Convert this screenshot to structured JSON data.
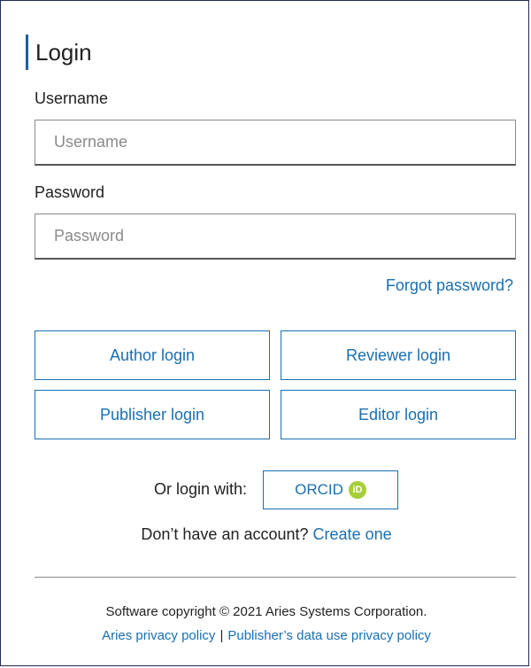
{
  "title": "Login",
  "username": {
    "label": "Username",
    "placeholder": "Username"
  },
  "password": {
    "label": "Password",
    "placeholder": "Password"
  },
  "forgot_password": "Forgot password?",
  "role_buttons": {
    "author": "Author login",
    "reviewer": "Reviewer login",
    "publisher": "Publisher login",
    "editor": "Editor login"
  },
  "orcid": {
    "prompt": "Or login with:",
    "button_label": "ORCID",
    "icon_text": "iD",
    "icon": "orcid-icon",
    "icon_color": "#a6ce39"
  },
  "account": {
    "prompt": "Don’t have an account?",
    "link": "Create one"
  },
  "footer": {
    "copyright": "Software copyright © 2021 Aries Systems Corporation.",
    "privacy_link": "Aries privacy policy",
    "separator": "|",
    "data_use_link": "Publisher’s data use privacy policy"
  },
  "colors": {
    "accent": "#1a6fb0",
    "border": "#1f2a5c"
  }
}
